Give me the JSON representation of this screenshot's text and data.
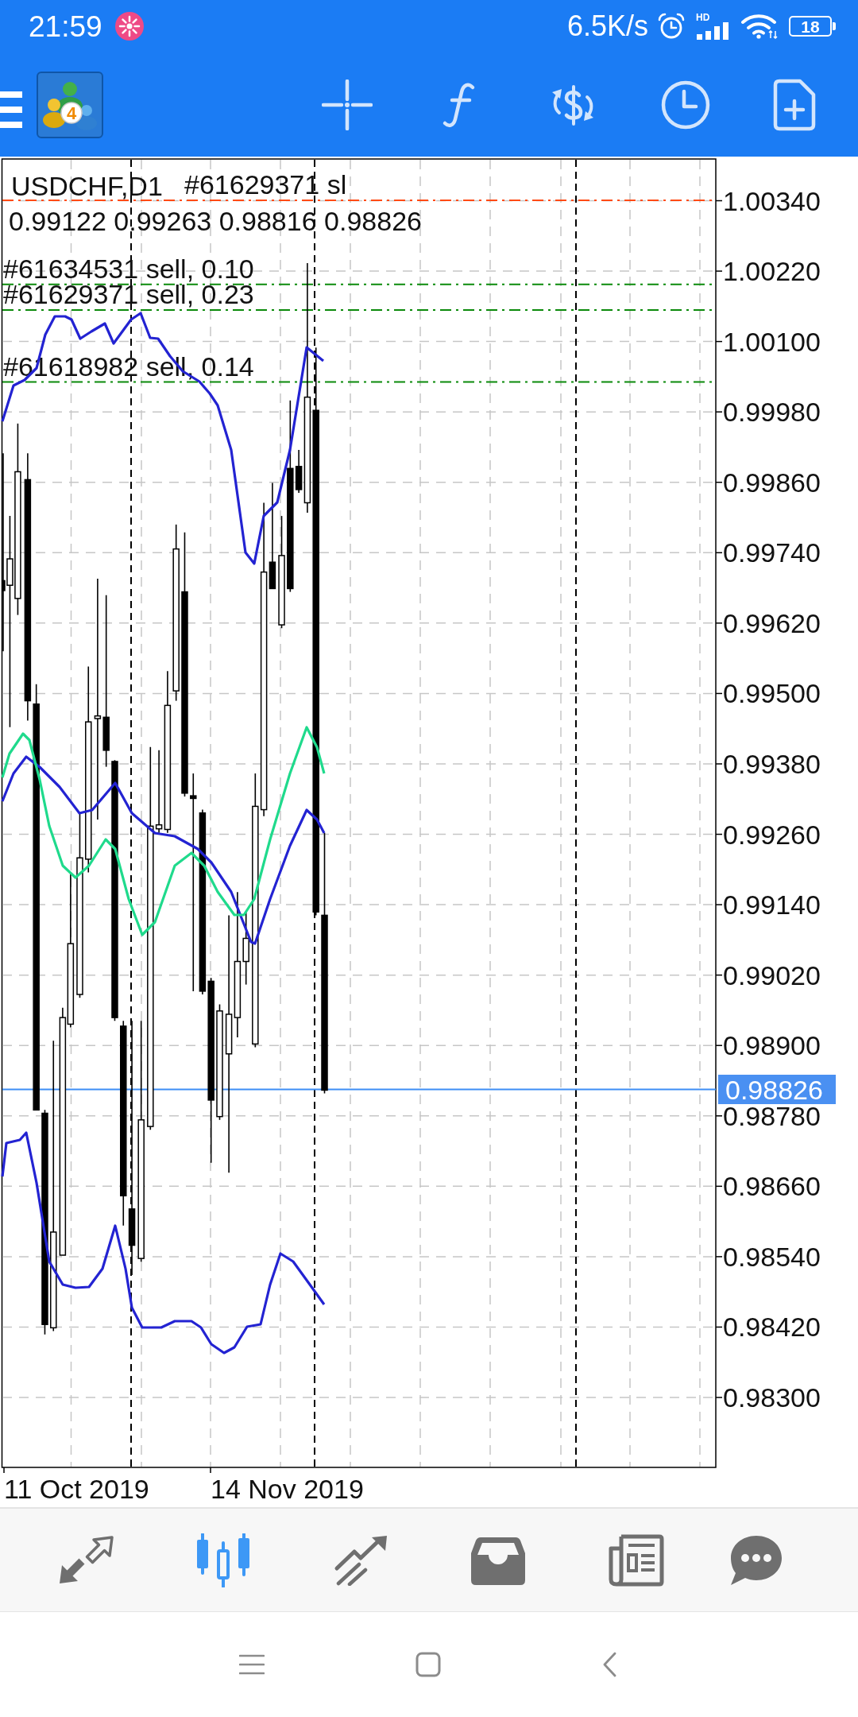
{
  "status_bar": {
    "time": "21:59",
    "network_speed": "6.5K/s",
    "signal_label": "HD",
    "battery": "18"
  },
  "toolbar": {
    "logo_badge": "4"
  },
  "chart": {
    "title": "USDCHF,D1",
    "ohlc": "0.99122 0.99263 0.98816 0.98826",
    "order_lines": [
      {
        "kind": "stop_loss",
        "label": "#61629371 sl"
      },
      {
        "kind": "order",
        "label": "#61634531 sell, 0.10"
      },
      {
        "kind": "order",
        "label": "#61629371 sell, 0.23"
      },
      {
        "kind": "order",
        "label": "#61618982 sell, 0.14"
      }
    ],
    "price_labels": [
      "1.00340",
      "1.00220",
      "1.00100",
      "0.99980",
      "0.99860",
      "0.99740",
      "0.99620",
      "0.99500",
      "0.99380",
      "0.99260",
      "0.99140",
      "0.99020",
      "0.98900",
      "0.98780",
      "0.98660",
      "0.98540",
      "0.98420",
      "0.98300"
    ],
    "current_price": "0.98826",
    "date_labels": [
      "11 Oct 2019",
      "14 Nov 2019"
    ]
  },
  "bottom_nav": [
    {
      "selected": false
    },
    {
      "selected": true
    },
    {
      "selected": false
    },
    {
      "selected": false
    },
    {
      "selected": false
    },
    {
      "selected": false
    }
  ]
}
